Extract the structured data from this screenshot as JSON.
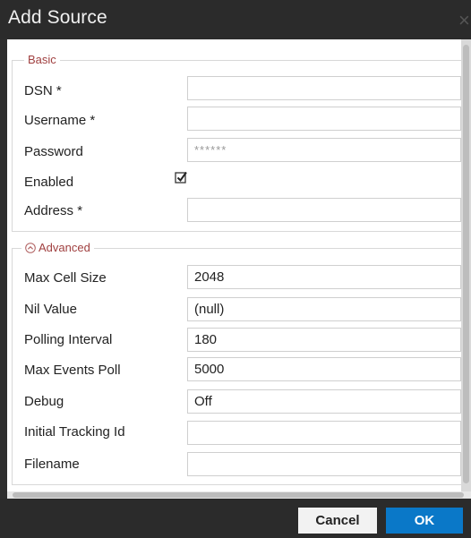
{
  "dialog": {
    "title": "Add Source",
    "close_glyph": "×"
  },
  "basic": {
    "legend": "Basic",
    "fields": [
      {
        "label": "DSN *",
        "value": ""
      },
      {
        "label": "Username *",
        "value": ""
      },
      {
        "label": "Password",
        "value": "******"
      },
      {
        "label": "Enabled",
        "checked": true
      },
      {
        "label": "Address *",
        "value": ""
      }
    ]
  },
  "advanced": {
    "legend": "Advanced",
    "toggle_icon": "chevron-up-circle-icon",
    "fields": [
      {
        "label": "Max Cell Size",
        "value": "2048"
      },
      {
        "label": "Nil Value",
        "value": "(null)"
      },
      {
        "label": "Polling Interval",
        "value": "180"
      },
      {
        "label": "Max Events Poll",
        "value": "5000"
      },
      {
        "label": "Debug",
        "value": "Off"
      },
      {
        "label": "Initial Tracking Id",
        "value": ""
      },
      {
        "label": "Filename",
        "value": ""
      }
    ]
  },
  "footer": {
    "cancel_label": "Cancel",
    "ok_label": "OK"
  },
  "colors": {
    "ok_button": "#0a78c8",
    "legend_text": "#a04040",
    "title_bar": "#2b2b2b"
  }
}
